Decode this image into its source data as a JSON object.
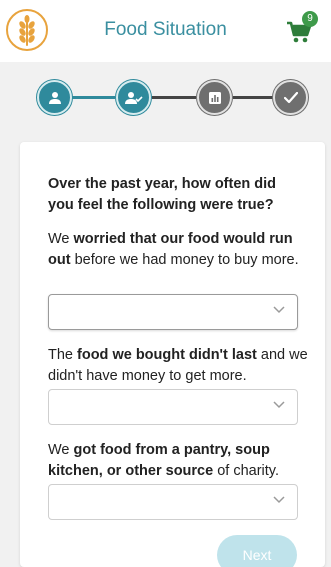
{
  "header": {
    "title": "Food Situation",
    "cart_count": "9",
    "logo_icon": "wheat-icon",
    "cart_icon": "shopping-cart-icon"
  },
  "stepper": {
    "steps": [
      {
        "icon": "user-icon",
        "state": "completed"
      },
      {
        "icon": "user-check-icon",
        "state": "current"
      },
      {
        "icon": "bar-chart-icon",
        "state": "upcoming"
      },
      {
        "icon": "check-icon",
        "state": "upcoming"
      }
    ]
  },
  "form": {
    "intro": "Over the past year, how often did you feel the following were true?",
    "questions": [
      {
        "pre": "We ",
        "bold": "worried that our food would run out",
        "post": " before we had money to buy more.",
        "value": ""
      },
      {
        "pre": "The ",
        "bold": "food we bought didn't last",
        "post": " and we didn't have money to get more.",
        "value": ""
      },
      {
        "pre": "We ",
        "bold": "got food from a pantry, soup kitchen, or other source",
        "post": " of charity.",
        "value": ""
      }
    ],
    "next_label": "Next"
  },
  "colors": {
    "accent": "#2f8a9c",
    "inactive": "#6f6f6f",
    "logo": "#e8a33d",
    "cart": "#2e7d3a"
  }
}
